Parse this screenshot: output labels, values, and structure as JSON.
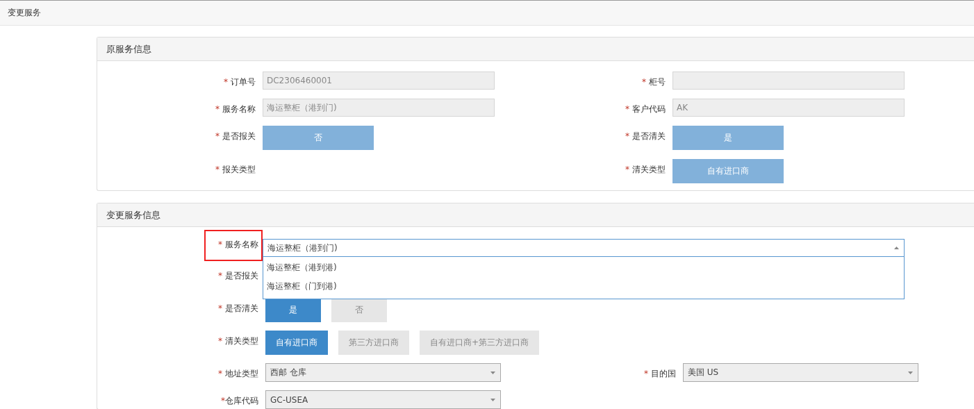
{
  "page_title": "变更服务",
  "sections": [
    {
      "title": "原服务信息",
      "disabled": true,
      "rows": [
        [
          {
            "kind": "input",
            "required_mark": "*",
            "label": "订单号",
            "value": "DC2306460001"
          },
          {
            "kind": "input",
            "required_mark": "*",
            "label": "柜号"
          }
        ],
        [
          {
            "kind": "input",
            "required_mark": "*",
            "label": "服务名称",
            "value": "海运整柜（港到门)"
          },
          {
            "kind": "input",
            "required_mark": "*",
            "label": "客户代码",
            "value": "AK"
          }
        ],
        [
          {
            "kind": "choice",
            "required_mark": "*",
            "label": "是否报关",
            "options": [
              {
                "label": "否",
                "selected": true
              }
            ]
          },
          {
            "kind": "choice",
            "required_mark": "*",
            "label": "是否清关",
            "options": [
              {
                "label": "是",
                "selected": true
              }
            ]
          }
        ],
        [
          {
            "kind": "choice",
            "required_mark": "*",
            "label": "报关类型"
          },
          {
            "kind": "choice",
            "required_mark": "*",
            "label": "清关类型",
            "options": [
              {
                "label": "自有进口商",
                "selected": true
              }
            ]
          }
        ]
      ]
    },
    {
      "title": "变更服务信息",
      "disabled": false,
      "rows": [
        [
          {
            "kind": "wide_select",
            "required_mark": "*",
            "label": "服务名称",
            "value": "海运整柜（港到门)",
            "expanded": true,
            "highlighted": true,
            "options": [
              {
                "label": "海运整柜（港到港)"
              },
              {
                "label": "海运整柜（门到港)"
              }
            ]
          }
        ],
        [
          {
            "kind": "choice",
            "required_mark": "*",
            "label": "是否报关"
          }
        ],
        [
          {
            "kind": "choice",
            "required_mark": "*",
            "label": "是否清关",
            "options": [
              {
                "label": "是",
                "selected": true
              },
              {
                "label": "否",
                "selected": false
              }
            ]
          }
        ],
        [
          {
            "kind": "choice",
            "required_mark": "*",
            "label": "清关类型",
            "options": [
              {
                "label": "自有进口商",
                "selected": true
              },
              {
                "label": "第三方进口商",
                "selected": false
              },
              {
                "label": "自有进口商+第三方进口商",
                "selected": false
              }
            ]
          }
        ],
        [
          {
            "kind": "select",
            "required_mark": "*",
            "label": "地址类型",
            "value": "西邮 仓库"
          },
          {
            "kind": "select",
            "required_mark": "*",
            "label": "目的国",
            "value": "美国 US"
          }
        ],
        [
          {
            "kind": "select",
            "required_mark": "*",
            "label": "仓库代码",
            "value": "GC-USEA",
            "tight": true
          }
        ]
      ]
    }
  ]
}
